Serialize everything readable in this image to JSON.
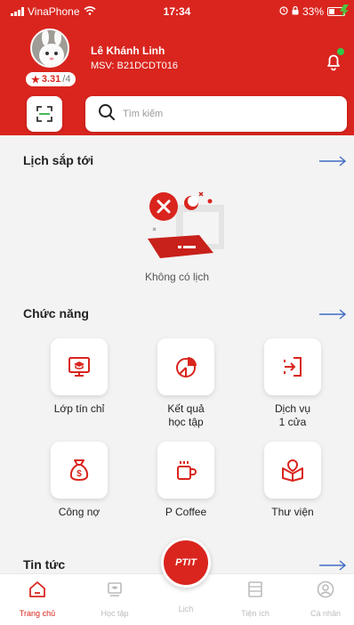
{
  "status_bar": {
    "carrier": "VinaPhone",
    "time": "17:34",
    "battery": "33%"
  },
  "profile": {
    "name": "Lê Khánh Linh",
    "student_id": "MSV: B21DCDT016",
    "rating_value": "3.31",
    "rating_max": "/4"
  },
  "search": {
    "placeholder": "Tìm kiếm"
  },
  "schedule": {
    "title": "Lịch sắp tới",
    "empty_text": "Không có lịch"
  },
  "functions": {
    "title": "Chức năng",
    "items": [
      {
        "label": "Lớp tín chỉ",
        "icon": "classroom-icon"
      },
      {
        "label": "Kết quả\nhọc tập",
        "icon": "chart-icon"
      },
      {
        "label": "Dịch vụ\n1 cửa",
        "icon": "door-icon"
      },
      {
        "label": "Công nợ",
        "icon": "money-bag-icon"
      },
      {
        "label": "P Coffee",
        "icon": "coffee-icon"
      },
      {
        "label": "Thư viện",
        "icon": "library-icon"
      }
    ]
  },
  "news": {
    "title": "Tin tức"
  },
  "bottom_nav": {
    "items": [
      {
        "label": "Trang chủ",
        "icon": "home-icon"
      },
      {
        "label": "Học tập",
        "icon": "study-icon"
      },
      {
        "label": "Lịch",
        "icon": "calendar-icon"
      },
      {
        "label": "Tiện ích",
        "icon": "utilities-icon"
      },
      {
        "label": "Cá nhân",
        "icon": "profile-icon"
      }
    ],
    "center_logo": "PTIT"
  },
  "colors": {
    "brand_red": "#d9251e",
    "background": "#f3f3f3",
    "inactive_gray": "#bcbcbc",
    "notification_green": "#31c84a"
  }
}
